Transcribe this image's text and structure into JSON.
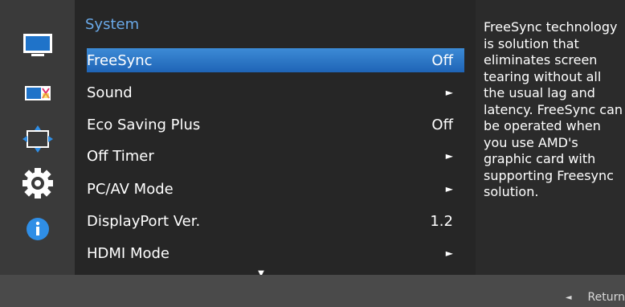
{
  "menu": {
    "title": "System",
    "items": [
      {
        "label": "FreeSync",
        "value": "Off",
        "selected": true
      },
      {
        "label": "Sound",
        "value": "►"
      },
      {
        "label": "Eco Saving Plus",
        "value": "Off"
      },
      {
        "label": "Off Timer",
        "value": "►"
      },
      {
        "label": "PC/AV Mode",
        "value": "►"
      },
      {
        "label": "DisplayPort Ver.",
        "value": "1.2"
      },
      {
        "label": "HDMI Mode",
        "value": "►"
      }
    ],
    "more_indicator": "▼"
  },
  "description": {
    "text": "FreeSync technology is solution that eliminates screen tearing without all the usual lag and latency. FreeSync can be operated when you use AMD's graphic card with supporting Freesync solution."
  },
  "footer": {
    "return_arrow": "◄",
    "return_label": "Return"
  },
  "sidebar": {
    "icons": [
      "picture-icon",
      "color-icon",
      "position-icon",
      "system-gear-icon",
      "information-icon"
    ]
  },
  "colors": {
    "selected": "#2d7ccf",
    "title": "#6aa9e8",
    "info": "#2f8ee6"
  }
}
